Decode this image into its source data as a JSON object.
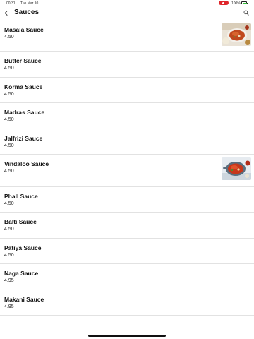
{
  "status_bar": {
    "time": "00:31",
    "date": "Tue Mar 10",
    "battery": "100%"
  },
  "header": {
    "title": "Sauces",
    "back_icon": "arrow-left-icon",
    "search_icon": "search-icon"
  },
  "items": [
    {
      "name": "Masala Sauce",
      "price": "4.50",
      "has_image": true
    },
    {
      "name": "Butter Sauce",
      "price": "4.50",
      "has_image": false
    },
    {
      "name": "Korma Sauce",
      "price": "4.50",
      "has_image": false
    },
    {
      "name": "Madras Sauce",
      "price": "4.50",
      "has_image": false
    },
    {
      "name": "Jalfrizi Sauce",
      "price": "4.50",
      "has_image": false
    },
    {
      "name": "Vindaloo Sauce",
      "price": "4.50",
      "has_image": true
    },
    {
      "name": "Phall Sauce",
      "price": "4.50",
      "has_image": false
    },
    {
      "name": "Balti Sauce",
      "price": "4.50",
      "has_image": false
    },
    {
      "name": "Patiya Sauce",
      "price": "4.50",
      "has_image": false
    },
    {
      "name": "Naga Sauce",
      "price": "4.95",
      "has_image": false
    },
    {
      "name": "Makani Sauce",
      "price": "4.95",
      "has_image": false
    }
  ],
  "colors": {
    "accent_record": "#e0262b",
    "battery": "#36c03a",
    "divider": "#e2e2e2"
  }
}
